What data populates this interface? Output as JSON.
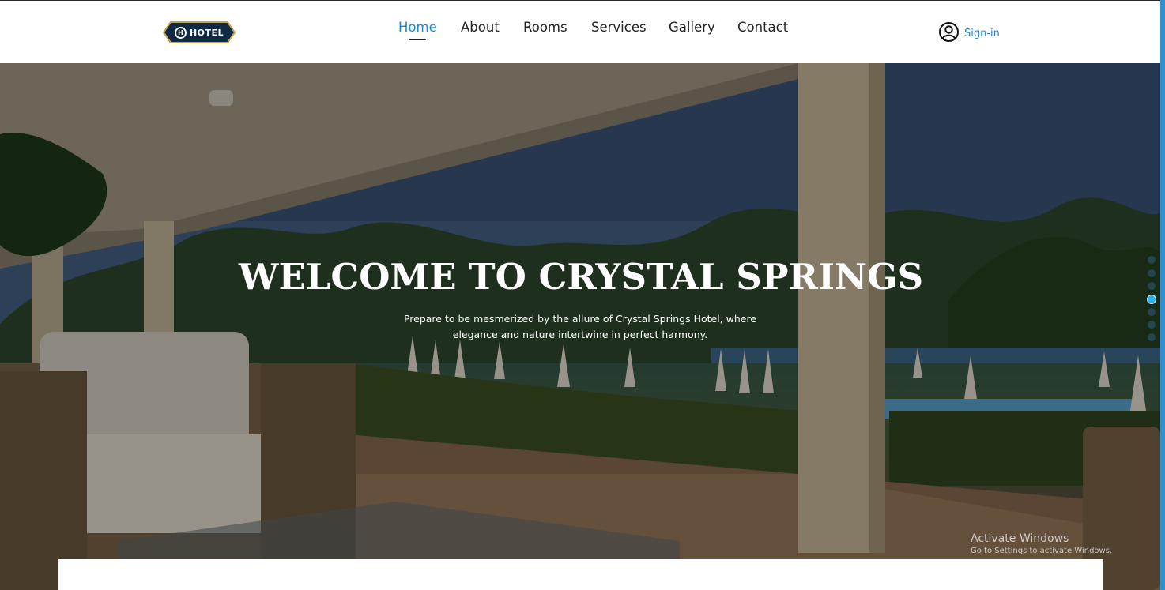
{
  "brand": {
    "logo_text": "HOTEL",
    "logo_mark": "H"
  },
  "nav": {
    "items": [
      {
        "label": "Home",
        "active": true
      },
      {
        "label": "About"
      },
      {
        "label": "Rooms"
      },
      {
        "label": "Services"
      },
      {
        "label": "Gallery"
      },
      {
        "label": "Contact"
      }
    ]
  },
  "auth": {
    "signin_label": "Sign-in",
    "icon": "user-circle-icon"
  },
  "hero": {
    "title": "WELCOME TO CRYSTAL SPRINGS",
    "subtitle": "Prepare to be mesmerized by the allure of Crystal Springs Hotel, where elegance and nature intertwine in perfect harmony.",
    "slides_total": 7,
    "active_slide": 3
  },
  "os_watermark": {
    "line1": "Activate Windows",
    "line2": "Go to Settings to activate Windows."
  },
  "colors": {
    "accent": "#1f86d4",
    "nav_text": "#222222",
    "logo_bg": "#0f2a44",
    "active_dot": "#2fb4e9"
  }
}
